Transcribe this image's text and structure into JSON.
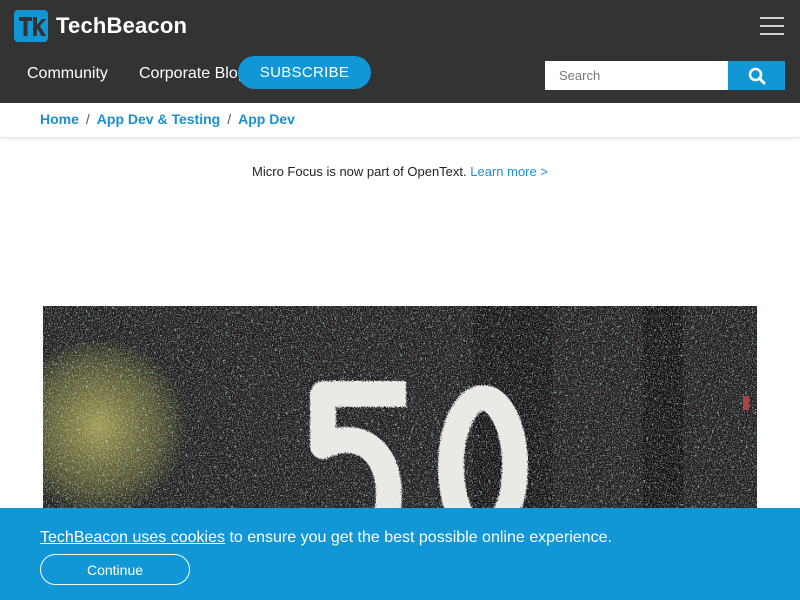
{
  "header": {
    "logo_text": "TechBeacon",
    "nav": [
      {
        "label": "Community"
      },
      {
        "label": "Corporate Blog"
      }
    ],
    "subscribe_label": "SUBSCRIBE",
    "search": {
      "placeholder": "Search"
    },
    "menu_icon": "hamburger-icon"
  },
  "breadcrumb": [
    "Home",
    "App Dev & Testing",
    "App Dev"
  ],
  "notice": {
    "text": "Micro Focus is now part of OpenText.",
    "link": "Learn more >"
  },
  "hero": {
    "numbers": "50"
  },
  "cookie": {
    "link_text": "TechBeacon uses cookies",
    "text": " to ensure you get the best possible online experience.",
    "button_label": "Continue"
  },
  "colors": {
    "header_bg": "#333333",
    "accent": "#1196d6",
    "link": "#1b8fd0"
  }
}
